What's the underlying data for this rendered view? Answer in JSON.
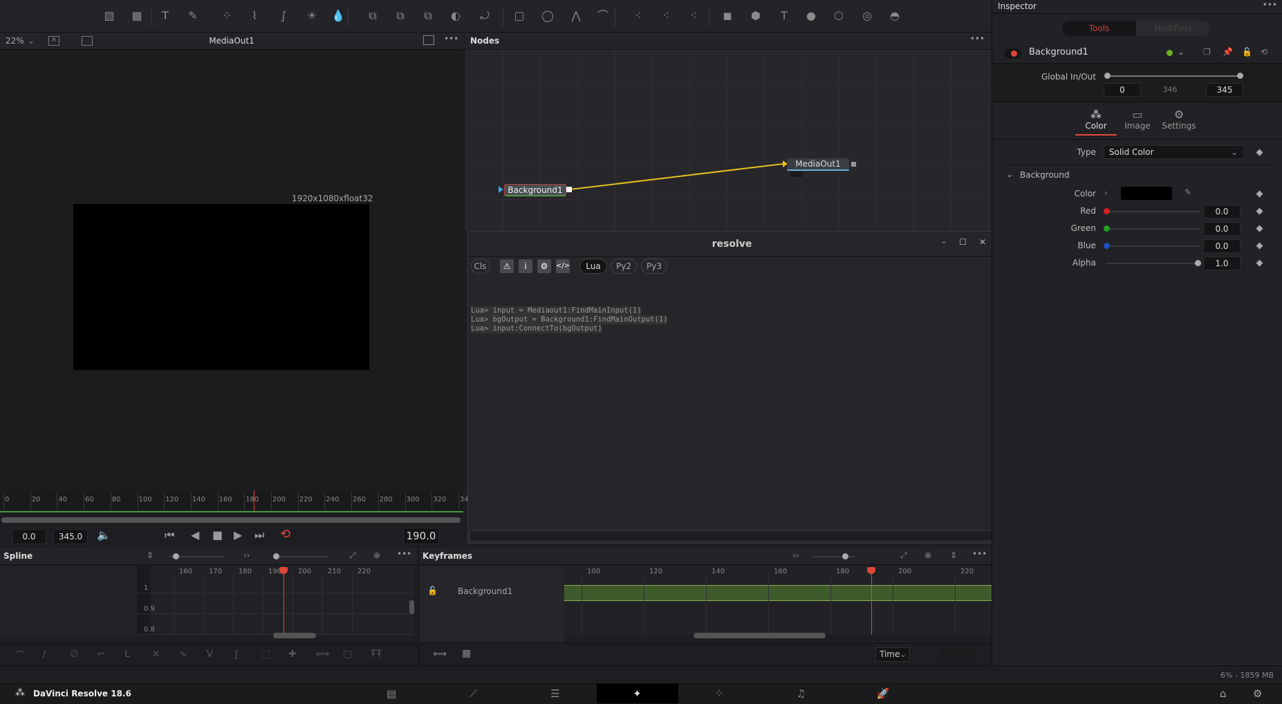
{
  "toolbar": {
    "icons": [
      "background-icon",
      "fast-noise-icon",
      "text-icon",
      "paint-icon",
      "particles-icon",
      "color-curves-icon",
      "color-corrector-icon",
      "brightness-contrast-icon",
      "blur-icon",
      "merge-icon",
      "matte-control-icon",
      "channel-booleans-icon",
      "mask-icon",
      "transform-icon",
      "rectangle-mask-icon",
      "ellipse-mask-icon",
      "polygon-mask-icon",
      "bspline-mask-icon",
      "pemitter-icon",
      "prender-icon",
      "pimage-icon",
      "shape3d-icon",
      "merge3d-icon",
      "text3d-icon",
      "renderer3d-icon",
      "camera3d-icon",
      "spotlight-icon",
      "image-plane-icon"
    ]
  },
  "viewer": {
    "zoom": "22%",
    "title": "MediaOut1",
    "resolution": "1920x1080xfloat32",
    "ruler_ticks": [
      "0",
      "20",
      "40",
      "60",
      "80",
      "100",
      "120",
      "140",
      "160",
      "180",
      "200",
      "220",
      "240",
      "260",
      "280",
      "300",
      "320",
      "34"
    ],
    "start": "0.0",
    "end": "345.0",
    "current": "190.0"
  },
  "nodes": {
    "title": "Nodes",
    "node1": "Background1",
    "node2": "MediaOut1"
  },
  "console": {
    "title": "resolve",
    "cls": "Cls",
    "langs": [
      "Lua",
      "Py2",
      "Py3"
    ],
    "active_lang": "Lua",
    "lines": [
      "Lua> input = Mediaout1:FindMainInput(1)",
      "Lua> bgOutput = Background1:FindMainOutput(1)",
      "Lua> input:ConnectTo(bgOutput)"
    ]
  },
  "inspector": {
    "title": "Inspector",
    "tabs": [
      "Tools",
      "Modifiers"
    ],
    "tool_name": "Background1",
    "global_label": "Global In/Out",
    "global_in": "0",
    "global_len": "346",
    "global_out": "345",
    "subtabs": [
      "Color",
      "Image",
      "Settings"
    ],
    "type_label": "Type",
    "type_value": "Solid Color",
    "section": "Background",
    "color_label": "Color",
    "channels": [
      {
        "label": "Red",
        "value": "0.0",
        "color": "#d42020",
        "level": 0
      },
      {
        "label": "Green",
        "value": "0.0",
        "color": "#20a020",
        "level": 0
      },
      {
        "label": "Blue",
        "value": "0.0",
        "color": "#2050c0",
        "level": 0
      },
      {
        "label": "Alpha",
        "value": "1.0",
        "color": "#aaaaaa",
        "level": 1
      }
    ]
  },
  "spline": {
    "title": "Spline",
    "x_ticks": [
      "160",
      "170",
      "180",
      "190",
      "200",
      "210",
      "220"
    ],
    "y_ticks": [
      "1",
      "0.9",
      "0.8"
    ]
  },
  "keyframes": {
    "title": "Keyframes",
    "track": "Background1",
    "x_ticks": [
      "100",
      "120",
      "140",
      "160",
      "180",
      "200",
      "220"
    ],
    "mode": "Time"
  },
  "status": {
    "memory": "6% - 1859 MB"
  },
  "app": {
    "name": "DaVinci Resolve 18.6",
    "pages": [
      "media-page-icon",
      "cut-page-icon",
      "edit-page-icon",
      "fusion-page-icon",
      "color-page-icon",
      "fairlight-page-icon",
      "deliver-page-icon"
    ],
    "active_page": 3
  },
  "colors": {
    "accent": "#e0463a",
    "link": "#e8c020",
    "keyframe_bar": "#3f5a2a"
  }
}
